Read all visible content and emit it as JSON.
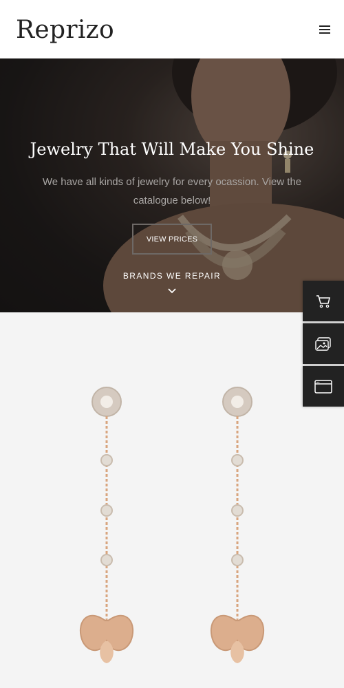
{
  "header": {
    "logo": "Reprizo",
    "menu_icon": "hamburger-icon"
  },
  "hero": {
    "title": "Jewelry That Will Make You Shine",
    "subtitle": "We have all kinds of jewelry for every ocassion. View the catalogue below!",
    "button_label": "VIEW PRICES",
    "brands_label": "BRANDS WE REPAIR",
    "scroll_icon": "chevron-down-icon"
  },
  "sidebar": {
    "items": [
      {
        "icon": "cart-icon"
      },
      {
        "icon": "gallery-icon"
      },
      {
        "icon": "browser-window-icon"
      }
    ]
  },
  "colors": {
    "header_bg": "#ffffff",
    "hero_overlay": "#231f1e",
    "sidebar_bg": "#222222",
    "product_bg": "#f4f4f4",
    "gold": "#d8a57e"
  }
}
